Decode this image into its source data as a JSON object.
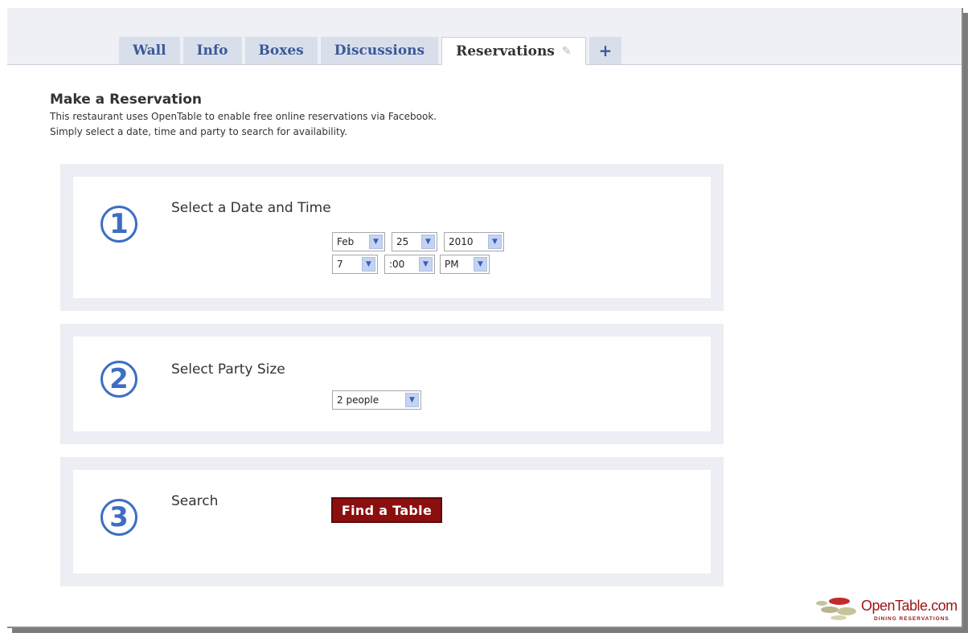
{
  "tabs": [
    {
      "label": "Wall"
    },
    {
      "label": "Info"
    },
    {
      "label": "Boxes"
    },
    {
      "label": "Discussions"
    },
    {
      "label": "Reservations",
      "active": true
    },
    {
      "label": "+"
    }
  ],
  "heading": "Make a Reservation",
  "description": [
    "This restaurant uses OpenTable to enable free online reservations via Facebook.",
    "Simply select a date, time and party to search for availability."
  ],
  "steps": [
    {
      "number": "1",
      "title": "Select a Date and Time"
    },
    {
      "number": "2",
      "title": "Select Party Size"
    },
    {
      "number": "3",
      "title": "Search"
    }
  ],
  "date": {
    "month": "Feb",
    "day": "25",
    "year": "2010"
  },
  "time": {
    "hour": "7",
    "minute": ":00",
    "ampm": "PM"
  },
  "party_size": "2 people",
  "find_button": "Find a Table",
  "logo": {
    "name": "OpenTable",
    "suffix": ".com",
    "tagline": "DINING RESERVATIONS"
  },
  "colors": {
    "accent": "#3b5998",
    "step_blue": "#3d6ec4",
    "button_red": "#8c0f0f"
  }
}
